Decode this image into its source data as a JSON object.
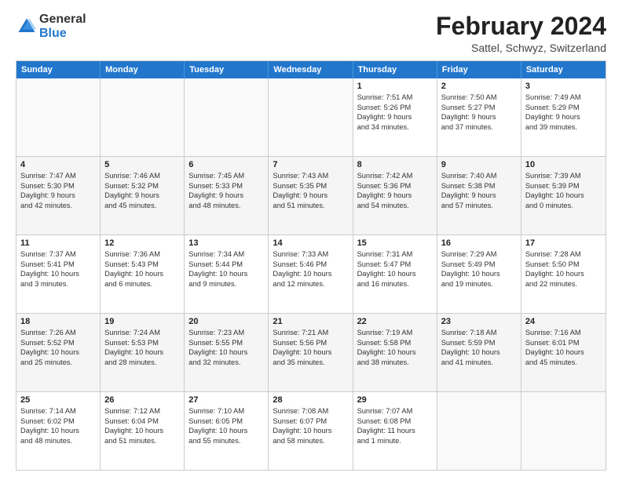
{
  "logo": {
    "general": "General",
    "blue": "Blue"
  },
  "title": "February 2024",
  "subtitle": "Sattel, Schwyz, Switzerland",
  "header_days": [
    "Sunday",
    "Monday",
    "Tuesday",
    "Wednesday",
    "Thursday",
    "Friday",
    "Saturday"
  ],
  "weeks": [
    [
      {
        "day": "",
        "lines": [],
        "empty": true
      },
      {
        "day": "",
        "lines": [],
        "empty": true
      },
      {
        "day": "",
        "lines": [],
        "empty": true
      },
      {
        "day": "",
        "lines": [],
        "empty": true
      },
      {
        "day": "1",
        "lines": [
          "Sunrise: 7:51 AM",
          "Sunset: 5:26 PM",
          "Daylight: 9 hours",
          "and 34 minutes."
        ]
      },
      {
        "day": "2",
        "lines": [
          "Sunrise: 7:50 AM",
          "Sunset: 5:27 PM",
          "Daylight: 9 hours",
          "and 37 minutes."
        ]
      },
      {
        "day": "3",
        "lines": [
          "Sunrise: 7:49 AM",
          "Sunset: 5:29 PM",
          "Daylight: 9 hours",
          "and 39 minutes."
        ]
      }
    ],
    [
      {
        "day": "4",
        "lines": [
          "Sunrise: 7:47 AM",
          "Sunset: 5:30 PM",
          "Daylight: 9 hours",
          "and 42 minutes."
        ]
      },
      {
        "day": "5",
        "lines": [
          "Sunrise: 7:46 AM",
          "Sunset: 5:32 PM",
          "Daylight: 9 hours",
          "and 45 minutes."
        ]
      },
      {
        "day": "6",
        "lines": [
          "Sunrise: 7:45 AM",
          "Sunset: 5:33 PM",
          "Daylight: 9 hours",
          "and 48 minutes."
        ]
      },
      {
        "day": "7",
        "lines": [
          "Sunrise: 7:43 AM",
          "Sunset: 5:35 PM",
          "Daylight: 9 hours",
          "and 51 minutes."
        ]
      },
      {
        "day": "8",
        "lines": [
          "Sunrise: 7:42 AM",
          "Sunset: 5:36 PM",
          "Daylight: 9 hours",
          "and 54 minutes."
        ]
      },
      {
        "day": "9",
        "lines": [
          "Sunrise: 7:40 AM",
          "Sunset: 5:38 PM",
          "Daylight: 9 hours",
          "and 57 minutes."
        ]
      },
      {
        "day": "10",
        "lines": [
          "Sunrise: 7:39 AM",
          "Sunset: 5:39 PM",
          "Daylight: 10 hours",
          "and 0 minutes."
        ]
      }
    ],
    [
      {
        "day": "11",
        "lines": [
          "Sunrise: 7:37 AM",
          "Sunset: 5:41 PM",
          "Daylight: 10 hours",
          "and 3 minutes."
        ]
      },
      {
        "day": "12",
        "lines": [
          "Sunrise: 7:36 AM",
          "Sunset: 5:43 PM",
          "Daylight: 10 hours",
          "and 6 minutes."
        ]
      },
      {
        "day": "13",
        "lines": [
          "Sunrise: 7:34 AM",
          "Sunset: 5:44 PM",
          "Daylight: 10 hours",
          "and 9 minutes."
        ]
      },
      {
        "day": "14",
        "lines": [
          "Sunrise: 7:33 AM",
          "Sunset: 5:46 PM",
          "Daylight: 10 hours",
          "and 12 minutes."
        ]
      },
      {
        "day": "15",
        "lines": [
          "Sunrise: 7:31 AM",
          "Sunset: 5:47 PM",
          "Daylight: 10 hours",
          "and 16 minutes."
        ]
      },
      {
        "day": "16",
        "lines": [
          "Sunrise: 7:29 AM",
          "Sunset: 5:49 PM",
          "Daylight: 10 hours",
          "and 19 minutes."
        ]
      },
      {
        "day": "17",
        "lines": [
          "Sunrise: 7:28 AM",
          "Sunset: 5:50 PM",
          "Daylight: 10 hours",
          "and 22 minutes."
        ]
      }
    ],
    [
      {
        "day": "18",
        "lines": [
          "Sunrise: 7:26 AM",
          "Sunset: 5:52 PM",
          "Daylight: 10 hours",
          "and 25 minutes."
        ]
      },
      {
        "day": "19",
        "lines": [
          "Sunrise: 7:24 AM",
          "Sunset: 5:53 PM",
          "Daylight: 10 hours",
          "and 28 minutes."
        ]
      },
      {
        "day": "20",
        "lines": [
          "Sunrise: 7:23 AM",
          "Sunset: 5:55 PM",
          "Daylight: 10 hours",
          "and 32 minutes."
        ]
      },
      {
        "day": "21",
        "lines": [
          "Sunrise: 7:21 AM",
          "Sunset: 5:56 PM",
          "Daylight: 10 hours",
          "and 35 minutes."
        ]
      },
      {
        "day": "22",
        "lines": [
          "Sunrise: 7:19 AM",
          "Sunset: 5:58 PM",
          "Daylight: 10 hours",
          "and 38 minutes."
        ]
      },
      {
        "day": "23",
        "lines": [
          "Sunrise: 7:18 AM",
          "Sunset: 5:59 PM",
          "Daylight: 10 hours",
          "and 41 minutes."
        ]
      },
      {
        "day": "24",
        "lines": [
          "Sunrise: 7:16 AM",
          "Sunset: 6:01 PM",
          "Daylight: 10 hours",
          "and 45 minutes."
        ]
      }
    ],
    [
      {
        "day": "25",
        "lines": [
          "Sunrise: 7:14 AM",
          "Sunset: 6:02 PM",
          "Daylight: 10 hours",
          "and 48 minutes."
        ]
      },
      {
        "day": "26",
        "lines": [
          "Sunrise: 7:12 AM",
          "Sunset: 6:04 PM",
          "Daylight: 10 hours",
          "and 51 minutes."
        ]
      },
      {
        "day": "27",
        "lines": [
          "Sunrise: 7:10 AM",
          "Sunset: 6:05 PM",
          "Daylight: 10 hours",
          "and 55 minutes."
        ]
      },
      {
        "day": "28",
        "lines": [
          "Sunrise: 7:08 AM",
          "Sunset: 6:07 PM",
          "Daylight: 10 hours",
          "and 58 minutes."
        ]
      },
      {
        "day": "29",
        "lines": [
          "Sunrise: 7:07 AM",
          "Sunset: 6:08 PM",
          "Daylight: 11 hours",
          "and 1 minute."
        ]
      },
      {
        "day": "",
        "lines": [],
        "empty": true
      },
      {
        "day": "",
        "lines": [],
        "empty": true
      }
    ]
  ]
}
